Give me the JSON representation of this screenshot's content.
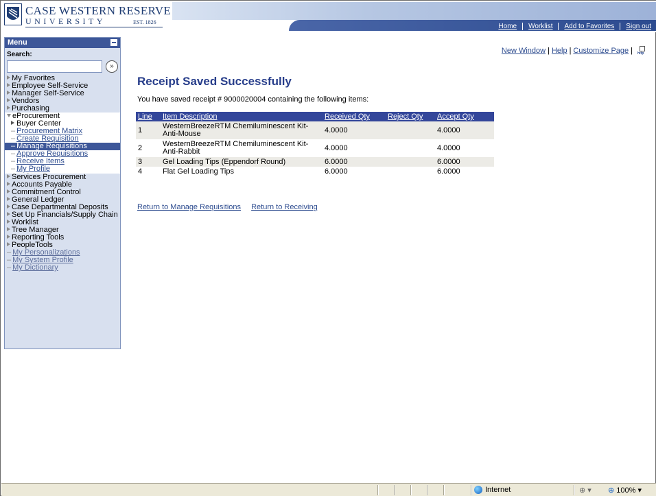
{
  "banner": {
    "logo_line1": "CASE WESTERN RESERVE",
    "logo_line2": "UNIVERSITY",
    "logo_est": "EST. 1826",
    "links": [
      "Home",
      "Worklist",
      "Add to Favorites",
      "Sign out"
    ]
  },
  "menu": {
    "title": "Menu",
    "search_label": "Search:",
    "search_value": "",
    "go_glyph": "»",
    "items_before": [
      "My Favorites",
      "Employee Self-Service",
      "Manager Self-Service",
      "Vendors",
      "Purchasing"
    ],
    "eprocurement": {
      "label": "eProcurement",
      "buyer_center": "Buyer Center",
      "subitems": [
        "Procurement Matrix",
        "Create Requisition",
        "Manage Requisitions",
        "Approve Requisitions",
        "Receive Items",
        "My Profile"
      ],
      "selected": "Manage Requisitions"
    },
    "items_after": [
      "Services Procurement",
      "Accounts Payable",
      "Commitment Control",
      "General Ledger",
      "Case Departmental Deposits",
      "Set Up Financials/Supply Chain",
      "Worklist",
      "Tree Manager",
      "Reporting Tools",
      "PeopleTools"
    ],
    "links": [
      "My Personalizations",
      "My System Profile",
      "My Dictionary"
    ]
  },
  "page_links": {
    "new_window": "New Window",
    "help": "Help",
    "customize": "Customize Page",
    "http_text": "http"
  },
  "page": {
    "title": "Receipt Saved Successfully",
    "message": "You have saved receipt # 9000020004 containing the following items:"
  },
  "table": {
    "headers": {
      "line": "Line",
      "item_description": "Item Description",
      "received_qty": "Received Qty",
      "reject_qty": "Reject Qty",
      "accept_qty": "Accept Qty"
    },
    "rows": [
      {
        "line": "1",
        "description_l1": "WesternBreezeRTM Chemiluminescent Kit-",
        "description_l2": "Anti-Mouse",
        "received": "4.0000",
        "reject": "",
        "accept": "4.0000"
      },
      {
        "line": "2",
        "description_l1": "WesternBreezeRTM Chemiluminescent Kit-",
        "description_l2": "Anti-Rabbit",
        "received": "4.0000",
        "reject": "",
        "accept": "4.0000"
      },
      {
        "line": "3",
        "description_l1": "Gel Loading Tips (Eppendorf Round)",
        "description_l2": "",
        "received": "6.0000",
        "reject": "",
        "accept": "6.0000"
      },
      {
        "line": "4",
        "description_l1": "Flat Gel Loading Tips",
        "description_l2": "",
        "received": "6.0000",
        "reject": "",
        "accept": "6.0000"
      }
    ]
  },
  "return_links": {
    "manage": "Return to Manage Requisitions",
    "receiving": "Return to Receiving"
  },
  "statusbar": {
    "zone": "Internet",
    "security_glyph": "⊕ ▾",
    "zoom": "100%",
    "zoom_arrow": "▾",
    "zoom_glyph": "⊕"
  }
}
